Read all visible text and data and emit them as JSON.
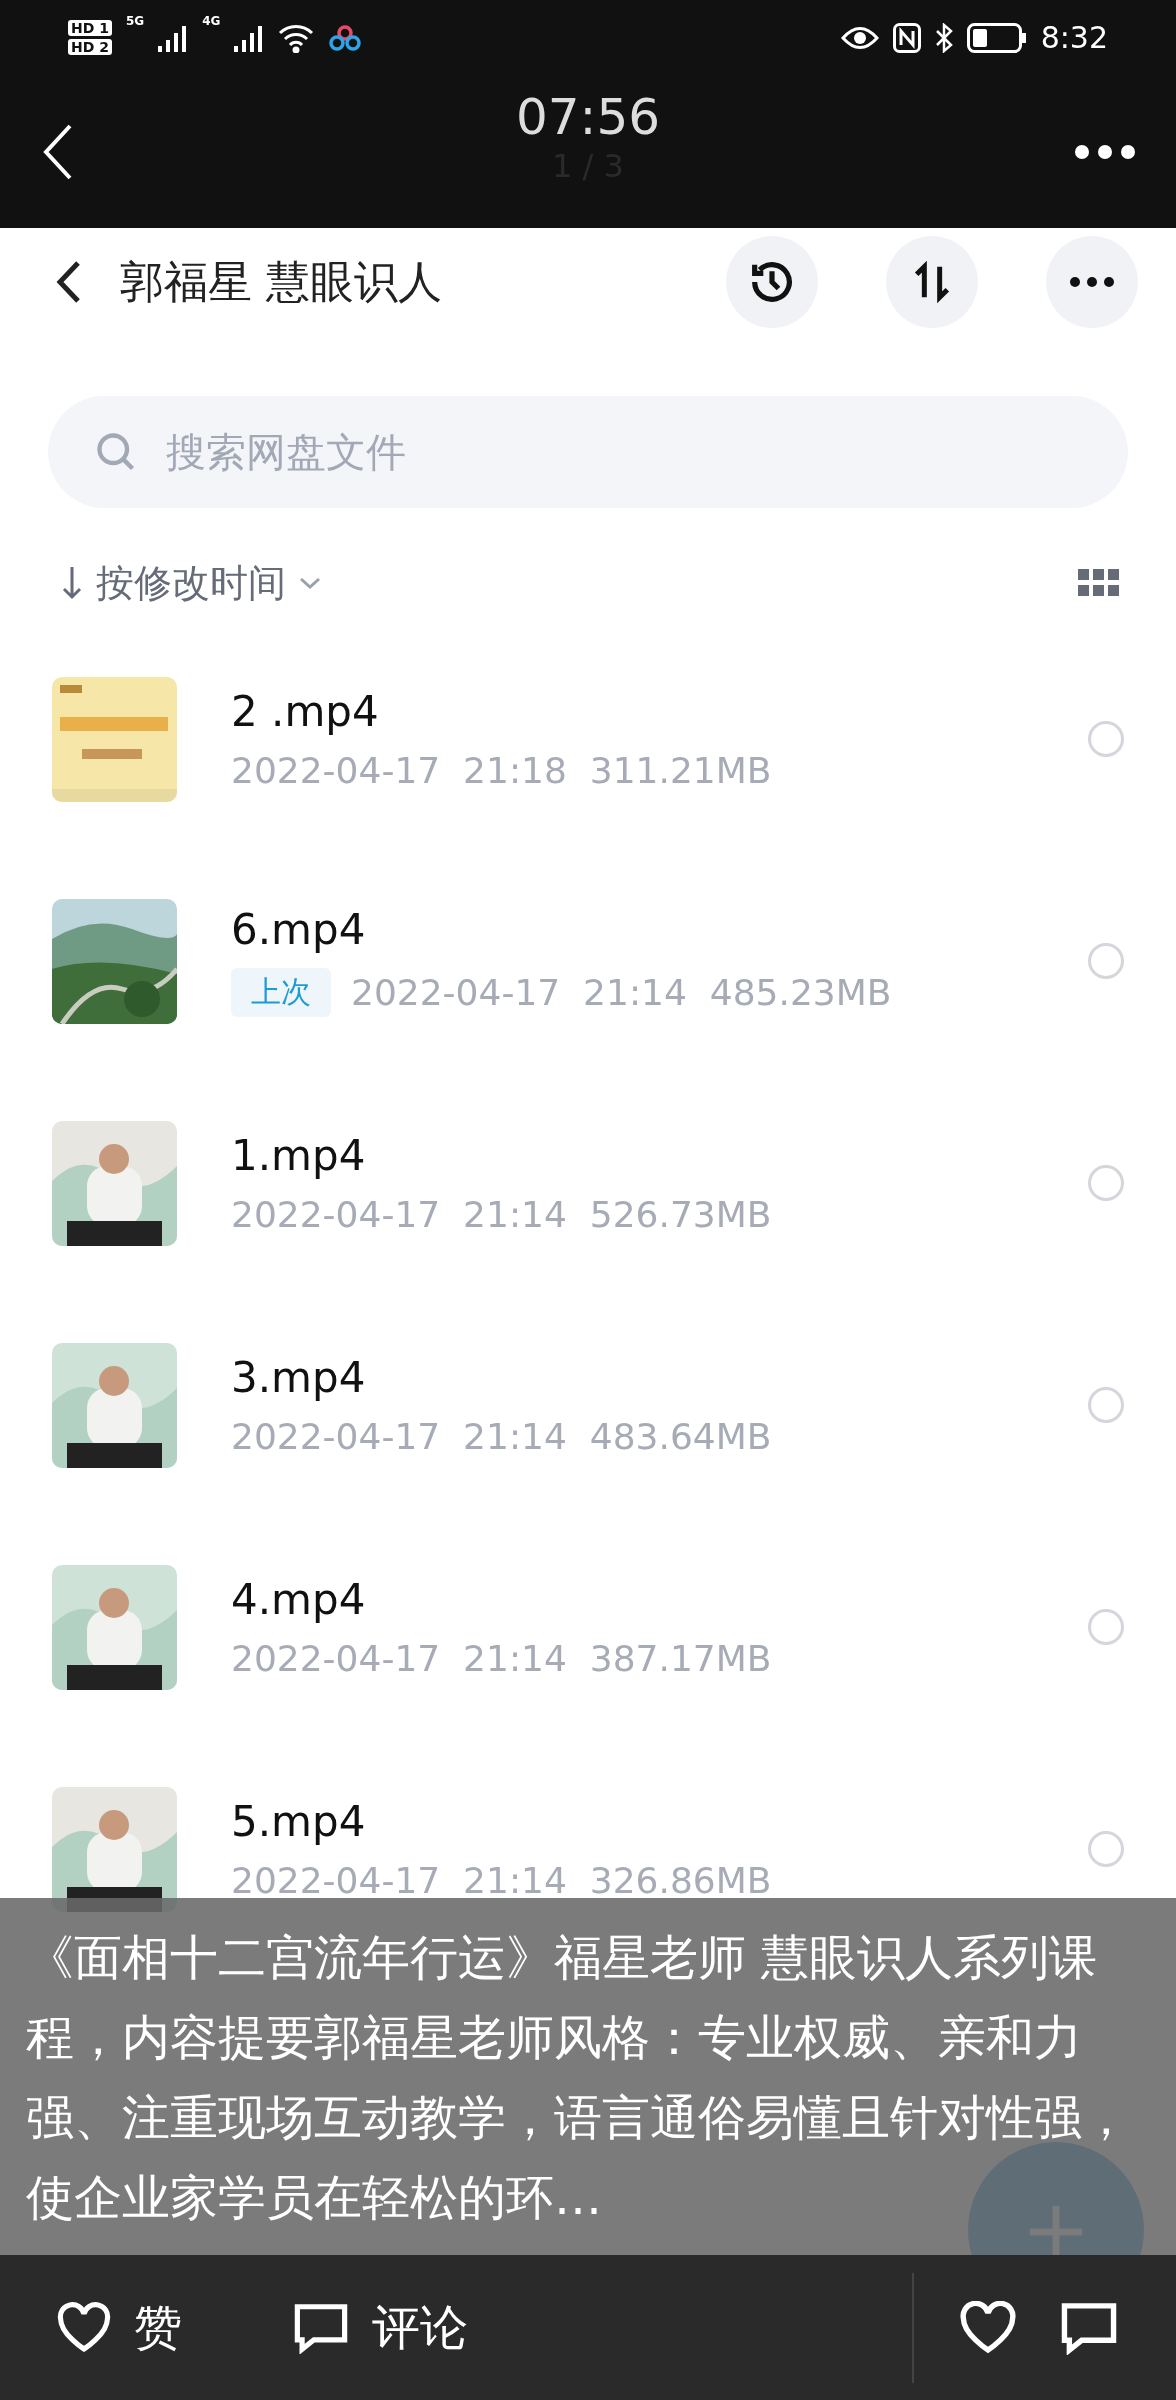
{
  "status_bar": {
    "sims": [
      {
        "label": "HD",
        "slot": "1"
      },
      {
        "label": "HD",
        "slot": "2"
      }
    ],
    "networks": [
      "5G",
      "4G"
    ],
    "time": "8:32"
  },
  "player_header": {
    "time": "07:56",
    "page": "1 / 3"
  },
  "app_bar": {
    "title": "郭福星 慧眼识人"
  },
  "search": {
    "placeholder": "搜索网盘文件"
  },
  "sort": {
    "label": "按修改时间"
  },
  "files": [
    {
      "name": "2 .mp4",
      "meta": "2022-04-17  21:18  311.21MB",
      "selected": false
    },
    {
      "name": "6.mp4",
      "badge": "上次",
      "meta": "2022-04-17  21:14  485.23MB",
      "selected": false
    },
    {
      "name": "1.mp4",
      "meta": "2022-04-17  21:14  526.73MB",
      "selected": false
    },
    {
      "name": "3.mp4",
      "meta": "2022-04-17  21:14  483.64MB",
      "selected": false
    },
    {
      "name": "4.mp4",
      "meta": "2022-04-17  21:14  387.17MB",
      "selected": false
    },
    {
      "name": "5.mp4",
      "meta": "2022-04-17  21:14  326.86MB",
      "selected": false
    }
  ],
  "caption": "《面相十二宫流年行运》福星老师 慧眼识人系列课程，内容提要郭福星老师风格：专业权威、亲和力强、注重现场互动教学，语言通俗易懂且针对性强，使企业家学员在轻松的环…",
  "bottom_bar": {
    "like": "赞",
    "comment": "评论"
  }
}
